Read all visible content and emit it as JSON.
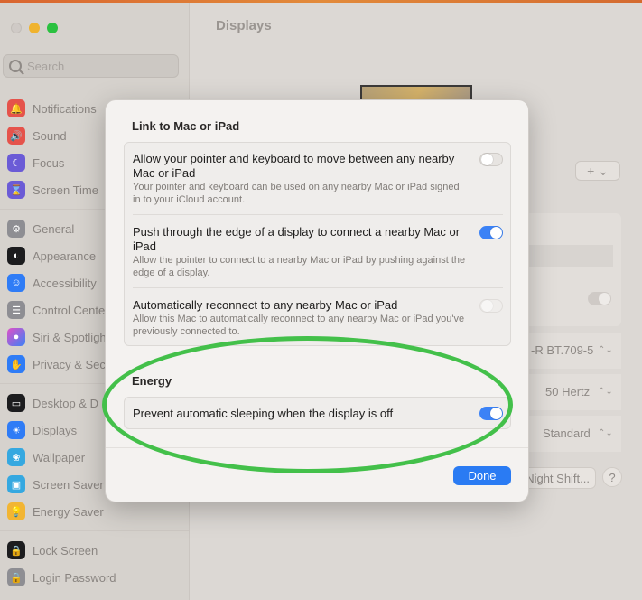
{
  "window": {
    "colors": {
      "close": "#fe5f57",
      "minimize": "#febc2e",
      "zoom": "#28c840",
      "accent": "#2a7bf3",
      "highlight": "#43c04a"
    }
  },
  "sidebar": {
    "search_placeholder": "Search",
    "items": [
      {
        "label": "Notifications",
        "icon": "bell-icon",
        "color": "#e5534b"
      },
      {
        "label": "Sound",
        "icon": "speaker-icon",
        "color": "#e5534b"
      },
      {
        "label": "Focus",
        "icon": "moon-icon",
        "color": "#6b5bd6"
      },
      {
        "label": "Screen Time",
        "icon": "hourglass-icon",
        "color": "#6b5bd6"
      },
      {
        "label": "General",
        "icon": "gear-icon",
        "color": "#8e8e93"
      },
      {
        "label": "Appearance",
        "icon": "appearance-icon",
        "color": "#1c1c1e"
      },
      {
        "label": "Accessibility",
        "icon": "accessibility-icon",
        "color": "#2f7cf6"
      },
      {
        "label": "Control Cente",
        "icon": "control-center-icon",
        "color": "#8e8e93"
      },
      {
        "label": "Siri & Spotligh",
        "icon": "siri-icon",
        "color": "#b044c9"
      },
      {
        "label": "Privacy & Sec",
        "icon": "hand-icon",
        "color": "#2f7cf6"
      },
      {
        "label": "Desktop & D",
        "icon": "desktop-icon",
        "color": "#1c1c1e"
      },
      {
        "label": "Displays",
        "icon": "sun-icon",
        "color": "#2f7cf6"
      },
      {
        "label": "Wallpaper",
        "icon": "flower-icon",
        "color": "#35a8e0"
      },
      {
        "label": "Screen Saver",
        "icon": "screen-saver-icon",
        "color": "#35a8e0"
      },
      {
        "label": "Energy Saver",
        "icon": "bulb-icon",
        "color": "#f2b533"
      },
      {
        "label": "Lock Screen",
        "icon": "lock-icon",
        "color": "#1c1c1e"
      },
      {
        "label": "Login Password",
        "icon": "lock-icon",
        "color": "#8e8e93"
      }
    ]
  },
  "main": {
    "title": "Displays",
    "add_button": "+ ⌄",
    "color_profile": "-R BT.709-5",
    "refresh_rate": "50 Hertz",
    "resolution": "Standard",
    "night_shift_button": "Night Shift...",
    "help_button": "?"
  },
  "dialog": {
    "link_section_title": "Link to Mac or iPad",
    "link_rows": [
      {
        "title": "Allow your pointer and keyboard to move between any nearby Mac or iPad",
        "description": "Your pointer and keyboard can be used on any nearby Mac or iPad signed in to your iCloud account.",
        "state": "off"
      },
      {
        "title": "Push through the edge of a display to connect a nearby Mac or iPad",
        "description": "Allow the pointer to connect to a nearby Mac or iPad by pushing against the edge of a display.",
        "state": "on"
      },
      {
        "title": "Automatically reconnect to any nearby Mac or iPad",
        "description": "Allow this Mac to automatically reconnect to any nearby Mac or iPad you've previously connected to.",
        "state": "disabled"
      }
    ],
    "energy_section_title": "Energy",
    "energy_row": {
      "title": "Prevent automatic sleeping when the display is off",
      "state": "on"
    },
    "done_button": "Done"
  }
}
